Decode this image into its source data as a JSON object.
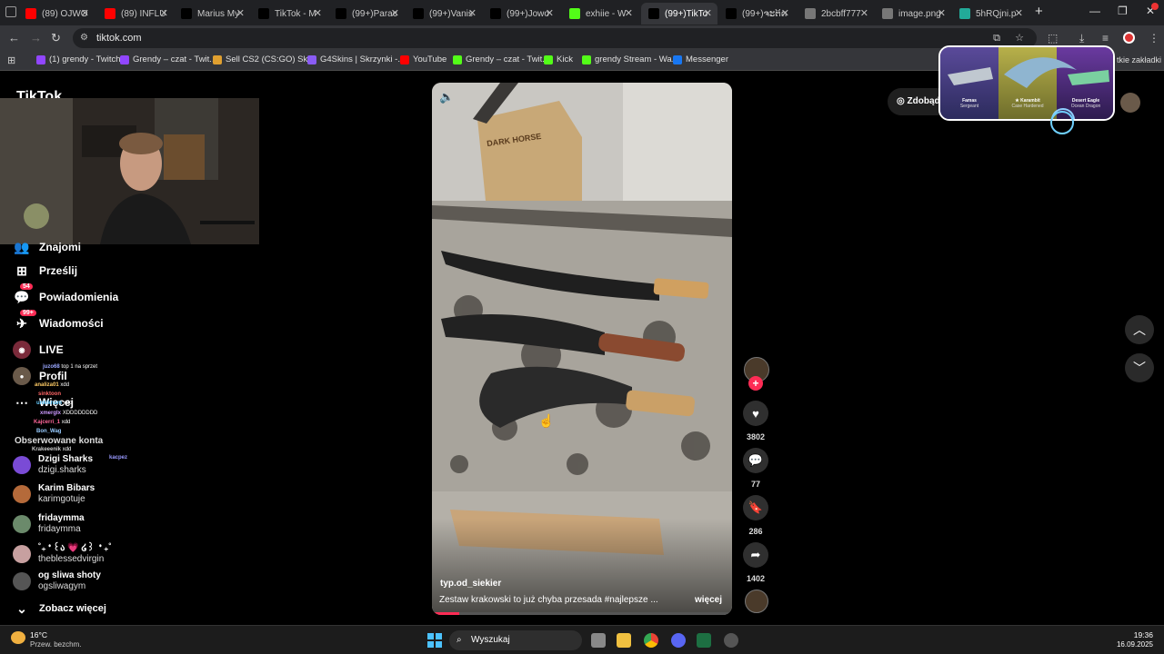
{
  "tabs": [
    {
      "label": "(89) OJWO",
      "fav": "yt"
    },
    {
      "label": "(89) INFLU",
      "fav": "yt"
    },
    {
      "label": "Marius My",
      "fav": "tt"
    },
    {
      "label": "TikTok - M",
      "fav": "tt"
    },
    {
      "label": "(99+)Parac",
      "fav": "tt"
    },
    {
      "label": "(99+)Vanis",
      "fav": "tt"
    },
    {
      "label": "(99+)Jowo",
      "fav": "tt"
    },
    {
      "label": "exhiie - W",
      "fav": "kick"
    },
    {
      "label": "(99+)TikTo",
      "fav": "tt",
      "active": true
    },
    {
      "label": "(99+)ຈະຕິດ",
      "fav": "tt"
    },
    {
      "label": "2bcbff777",
      "fav": "globe"
    },
    {
      "label": "image.png",
      "fav": "globe"
    },
    {
      "label": "5hRQjni.p",
      "fav": "img"
    }
  ],
  "address": {
    "url": "tiktok.com"
  },
  "bookmarks": [
    {
      "label": "(1) grendy - Twitch",
      "color": "#9146ff"
    },
    {
      "label": "Grendy – czat - Twit...",
      "color": "#9146ff"
    },
    {
      "label": "Sell CS2 (CS:GO) Ski...",
      "color": "#e0a030"
    },
    {
      "label": "G4Skins | Skrzynki -...",
      "color": "#8a5cf5"
    },
    {
      "label": "YouTube",
      "color": "#ff0000"
    },
    {
      "label": "Grendy – czat - Twit...",
      "color": "#53fc18"
    },
    {
      "label": "Kick",
      "color": "#53fc18"
    },
    {
      "label": "grendy Stream - Wa...",
      "color": "#53fc18"
    },
    {
      "label": "Messenger",
      "color": "#1877f2"
    }
  ],
  "bookmarks_more": "tkie zakładki",
  "sidebar": {
    "logo": "TikTok",
    "items": [
      {
        "label": "Znajomi",
        "icon": "friends-icon"
      },
      {
        "label": "Prześlij",
        "icon": "upload-icon"
      },
      {
        "label": "Powiadomienia",
        "icon": "inbox-icon",
        "badge": "54"
      },
      {
        "label": "Wiadomości",
        "icon": "messages-icon",
        "badge": "99+"
      },
      {
        "label": "LIVE",
        "icon": "live-icon"
      },
      {
        "label": "Profil",
        "icon": "avatar"
      },
      {
        "label": "Więcej",
        "icon": "more-icon"
      }
    ],
    "following_title": "Obserwowane konta",
    "following": [
      {
        "name": "Dzigi Sharks",
        "handle": "dzigi.sharks",
        "color": "#7a4bd6"
      },
      {
        "name": "Karim Bibars",
        "handle": "karimgotuje",
        "color": "#b56a3a"
      },
      {
        "name": "fridaymma",
        "handle": "fridaymma",
        "color": "#6b8a6b"
      },
      {
        "name": "˚₊‧꒰ა 💗 ໒꒱ ‧₊˚",
        "handle": "theblessedvirgin",
        "color": "#c7a0a0"
      },
      {
        "name": "og sliwa shoty",
        "handle": "ogsliwagym",
        "color": "#555"
      }
    ],
    "see_more": "Zobacz więcej"
  },
  "chat": [
    {
      "user": "juzo68",
      "msg": "top 1 na sprzet",
      "color": "#9aa7ff"
    },
    {
      "user": "analiza01",
      "msg": "xdd",
      "color": "#ffcc66"
    },
    {
      "user": "sinktoon",
      "msg": "",
      "color": "#ff6666"
    },
    {
      "user": "unkiknam",
      "msg": "xdd",
      "color": "#66ccff"
    },
    {
      "user": "xmerglx",
      "msg": "XDDDDDDDD",
      "color": "#cc99ff"
    },
    {
      "user": "Kajcerri_1",
      "msg": "xdd",
      "color": "#ff6699"
    },
    {
      "user": "Bon_Wag",
      "msg": "",
      "color": "#99ccff"
    },
    {
      "user": "Krakeeenik",
      "msg": "xdd",
      "color": "#cccccc"
    },
    {
      "user": "kacpez",
      "msg": "",
      "color": "#9999ff"
    }
  ],
  "video": {
    "author": "typ.od_siekier",
    "caption": "Zestaw krakowski to już chyba przesada #najlepsze ...",
    "more": "więcej",
    "box_text": "DARK HORSE"
  },
  "actions": {
    "likes": "3802",
    "comments": "77",
    "saves": "286",
    "shares": "1402"
  },
  "promo": {
    "button": "Zdobąd",
    "items": [
      {
        "name": "Famas",
        "sub": "Sergeant"
      },
      {
        "name": "★ Karambit",
        "sub": "Case Hardened"
      },
      {
        "name": "Desert Eagle",
        "sub": "Ocean Dragon"
      }
    ]
  },
  "taskbar": {
    "temp": "16°C",
    "weather": "Przew. bezchm.",
    "search": "Wyszukaj",
    "time": "19:36",
    "date": "16.09.2025"
  }
}
